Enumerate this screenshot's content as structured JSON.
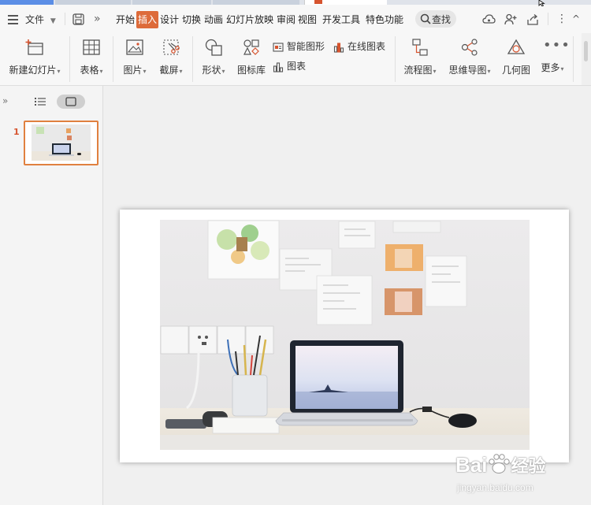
{
  "menu": {
    "file_label": "文件",
    "tabs": [
      {
        "label": "开始"
      },
      {
        "label": "插入"
      },
      {
        "label": "设计"
      },
      {
        "label": "切换"
      },
      {
        "label": "动画"
      },
      {
        "label": "幻灯片放映"
      },
      {
        "label": "审阅"
      },
      {
        "label": "视图"
      },
      {
        "label": "开发工具"
      },
      {
        "label": "特色功能"
      }
    ],
    "active_tab": "插入",
    "search_label": "查找"
  },
  "ribbon": {
    "new_slide": "新建幻灯片",
    "table": "表格",
    "picture": "图片",
    "screenshot": "截屏",
    "shape": "形状",
    "icon_library": "图标库",
    "smart_art": "智能图形",
    "chart": "图表",
    "online_chart": "在线图表",
    "flowchart": "流程图",
    "mind_map": "思维导图",
    "geometry": "几何图",
    "more": "更多"
  },
  "slides_panel": {
    "slide_number": "1"
  },
  "watermark": {
    "brand": "Bai",
    "brand_cn": "经验",
    "url": "jingyan.baidu.com"
  },
  "colors": {
    "accent": "#dd6b3a",
    "thumb_border": "#e0803f"
  }
}
